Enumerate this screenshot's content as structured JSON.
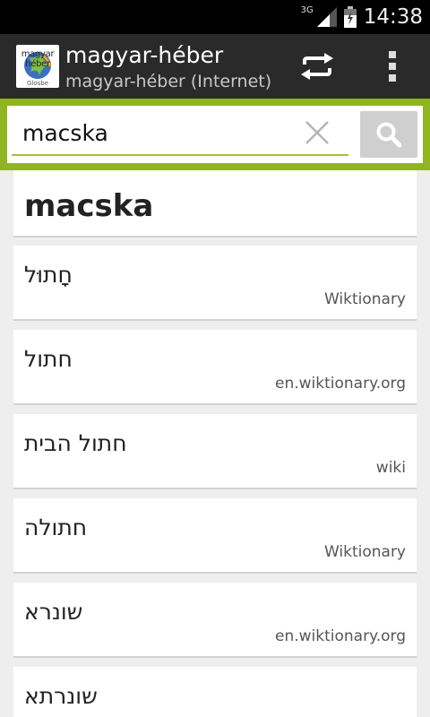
{
  "status_bar": {
    "network_label": "3G",
    "time": "14:38"
  },
  "action_bar": {
    "app_icon_text_line1": "magyar",
    "app_icon_text_line2": "héber",
    "app_icon_brand": "Glosbe",
    "title": "magyar-héber",
    "subtitle": "magyar-héber (Internet)"
  },
  "search": {
    "query": "macska"
  },
  "results": {
    "headword": "macska",
    "items": [
      {
        "translation": "חָתוּל",
        "source": "Wiktionary"
      },
      {
        "translation": "חתול",
        "source": "en.wiktionary.org"
      },
      {
        "translation": "חתול הבית",
        "source": "wiki"
      },
      {
        "translation": "חתולה",
        "source": "Wiktionary"
      },
      {
        "translation": "שונרא",
        "source": "en.wiktionary.org"
      },
      {
        "translation": "שונרתא",
        "source": ""
      }
    ]
  },
  "colors": {
    "accent_green": "#8fb521",
    "action_bar": "#2a2a2a"
  }
}
